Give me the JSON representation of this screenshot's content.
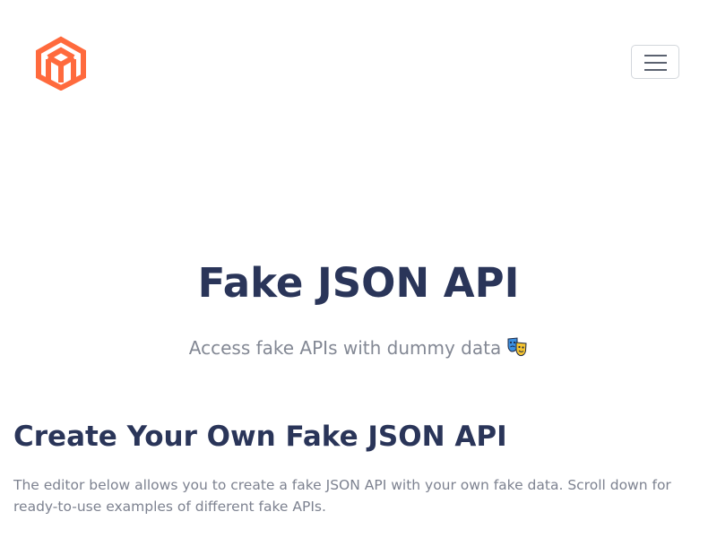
{
  "header": {
    "logo_icon": "cube-m-logo-icon",
    "menu_icon": "hamburger-menu-icon",
    "brand_color": "#ff6a3d"
  },
  "hero": {
    "title": "Fake JSON API",
    "subtitle": "Access fake APIs with dummy data",
    "emoji_icon": "theater-masks-icon"
  },
  "section": {
    "title": "Create Your Own Fake JSON API",
    "description": "The editor below allows you to create a fake JSON API with your own fake data. Scroll down for ready-to-use examples of different fake APIs."
  },
  "colors": {
    "heading": "#2a3559",
    "muted_text": "#838894"
  }
}
